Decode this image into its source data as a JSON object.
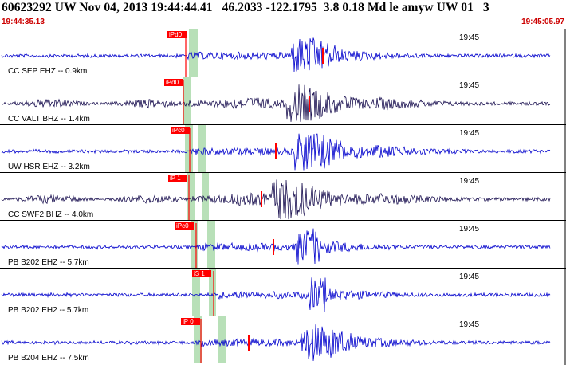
{
  "header": {
    "title": "60623292 UW Nov 04, 2013 19:44:44.41   46.2033 -122.1795  3.8 0.18 Md le amyw UW 01   3",
    "start_time": "19:44:35.13",
    "end_time": "19:45:05.97"
  },
  "time_tick_label": "19:45",
  "colors": {
    "trace": "#0000cc",
    "trace_dark": "#1a1050",
    "pick": "#ff0000",
    "window": "#b8e0b8",
    "frame": "#000000",
    "label_red": "#cc0000"
  },
  "channels": [
    {
      "label": "CC SEP EHZ -- 0.9km",
      "pick": "iPd0",
      "amp": 1.0,
      "dark": false
    },
    {
      "label": "CC VALT BHZ -- 1.4km",
      "pick": "iPd0",
      "amp": 1.0,
      "dark": true
    },
    {
      "label": "UW HSR EHZ -- 3.2km",
      "pick": "iPc0",
      "amp": 1.1,
      "dark": false
    },
    {
      "label": "CC SWF2 BHZ -- 4.0km",
      "pick": "iP 1",
      "amp": 1.2,
      "dark": true
    },
    {
      "label": "PB B202 EHZ -- 5.7km",
      "pick": "iPc0",
      "amp": 1.0,
      "dark": false
    },
    {
      "label": "PB B202 EH2 -- 5.7km",
      "pick": "iS 1",
      "amp": 1.0,
      "dark": false
    },
    {
      "label": "PB B204 EHZ -- 7.5km",
      "pick": "iP 0",
      "amp": 1.0,
      "dark": false
    }
  ]
}
